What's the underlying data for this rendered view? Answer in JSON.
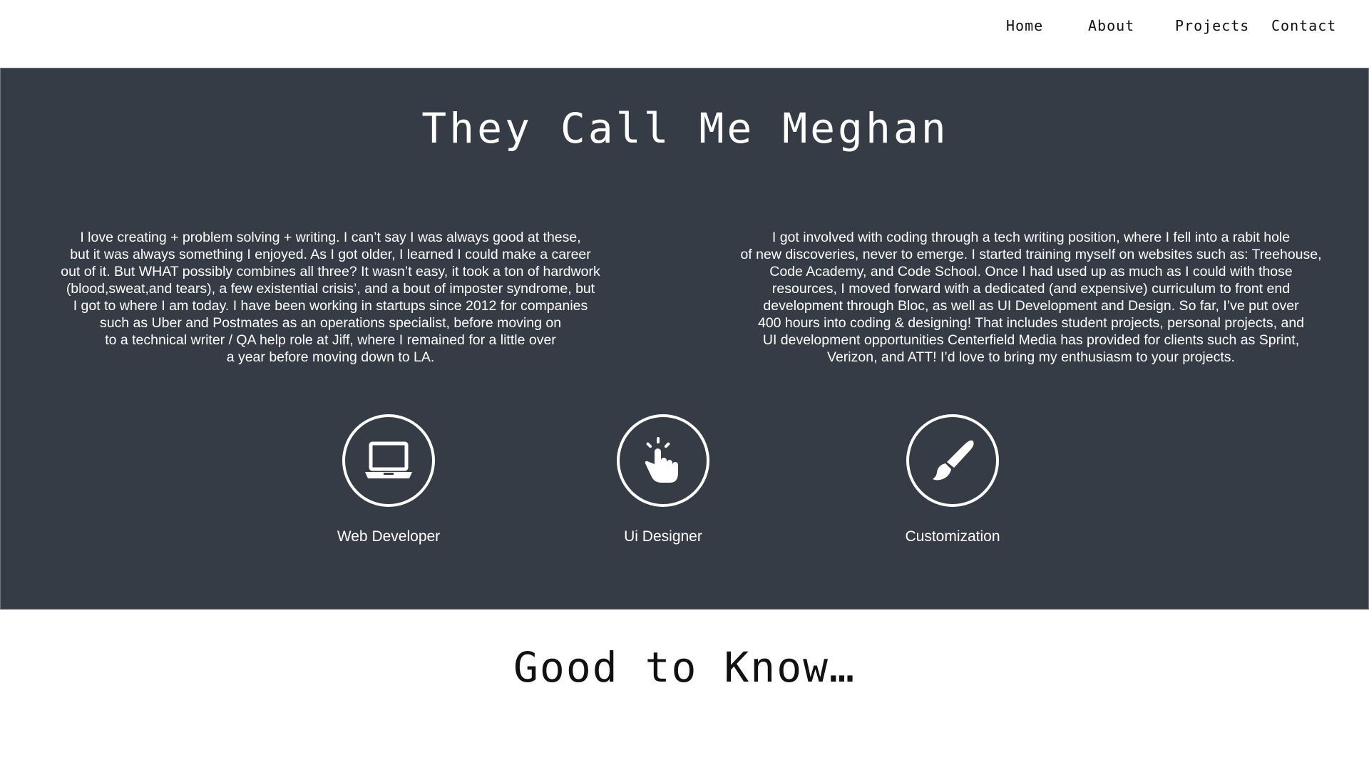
{
  "nav": {
    "items": [
      {
        "label": "Home"
      },
      {
        "label": "About"
      },
      {
        "label": "Projects"
      },
      {
        "label": "Contact"
      }
    ]
  },
  "about": {
    "title": "They Call Me Meghan",
    "left_lines": [
      "I love creating + problem solving + writing. I can’t say I was always good at these,",
      "but it was always something I enjoyed. As I got older, I learned I could make a career",
      "out of it. But WHAT possibly combines all three? It wasn’t easy, it took a ton of hardwork",
      "(blood,sweat,and tears), a few existential crisis’, and a bout of imposter syndrome, but",
      "I got to where I am today. I have been working in startups since 2012 for companies",
      "such as Uber and Postmates as an operations specialist, before moving on",
      "to a technical writer / QA help role at Jiff, where I remained for a little over",
      "a year before moving down to LA."
    ],
    "right_lines": [
      "I got involved with coding through a tech writing position, where I fell into a rabit hole",
      "of new discoveries, never to emerge. I started training myself on websites such as: Treehouse,",
      "Code Academy, and Code School. Once I had used up as much as I could with those",
      "resources, I moved forward with a dedicated (and expensive) curriculum to front end",
      "development through Bloc, as well as UI Development and Design. So far, I’ve put over",
      "400 hours into coding & designing! That includes student projects, personal projects, and",
      "UI development opportunities Centerfield Media has provided for clients such as Sprint,",
      "Verizon, and ATT! I’d love to bring my enthusiasm to your projects."
    ],
    "skills": [
      {
        "label": "Web Developer",
        "icon": "laptop-icon"
      },
      {
        "label": "Ui Designer",
        "icon": "pointer-hand-icon"
      },
      {
        "label": "Customization",
        "icon": "paintbrush-icon"
      }
    ]
  },
  "good_to_know": {
    "title": "Good to Know…"
  },
  "colors": {
    "section_bg": "#353c46",
    "text_light": "#ffffff",
    "text_dark": "#111111"
  }
}
